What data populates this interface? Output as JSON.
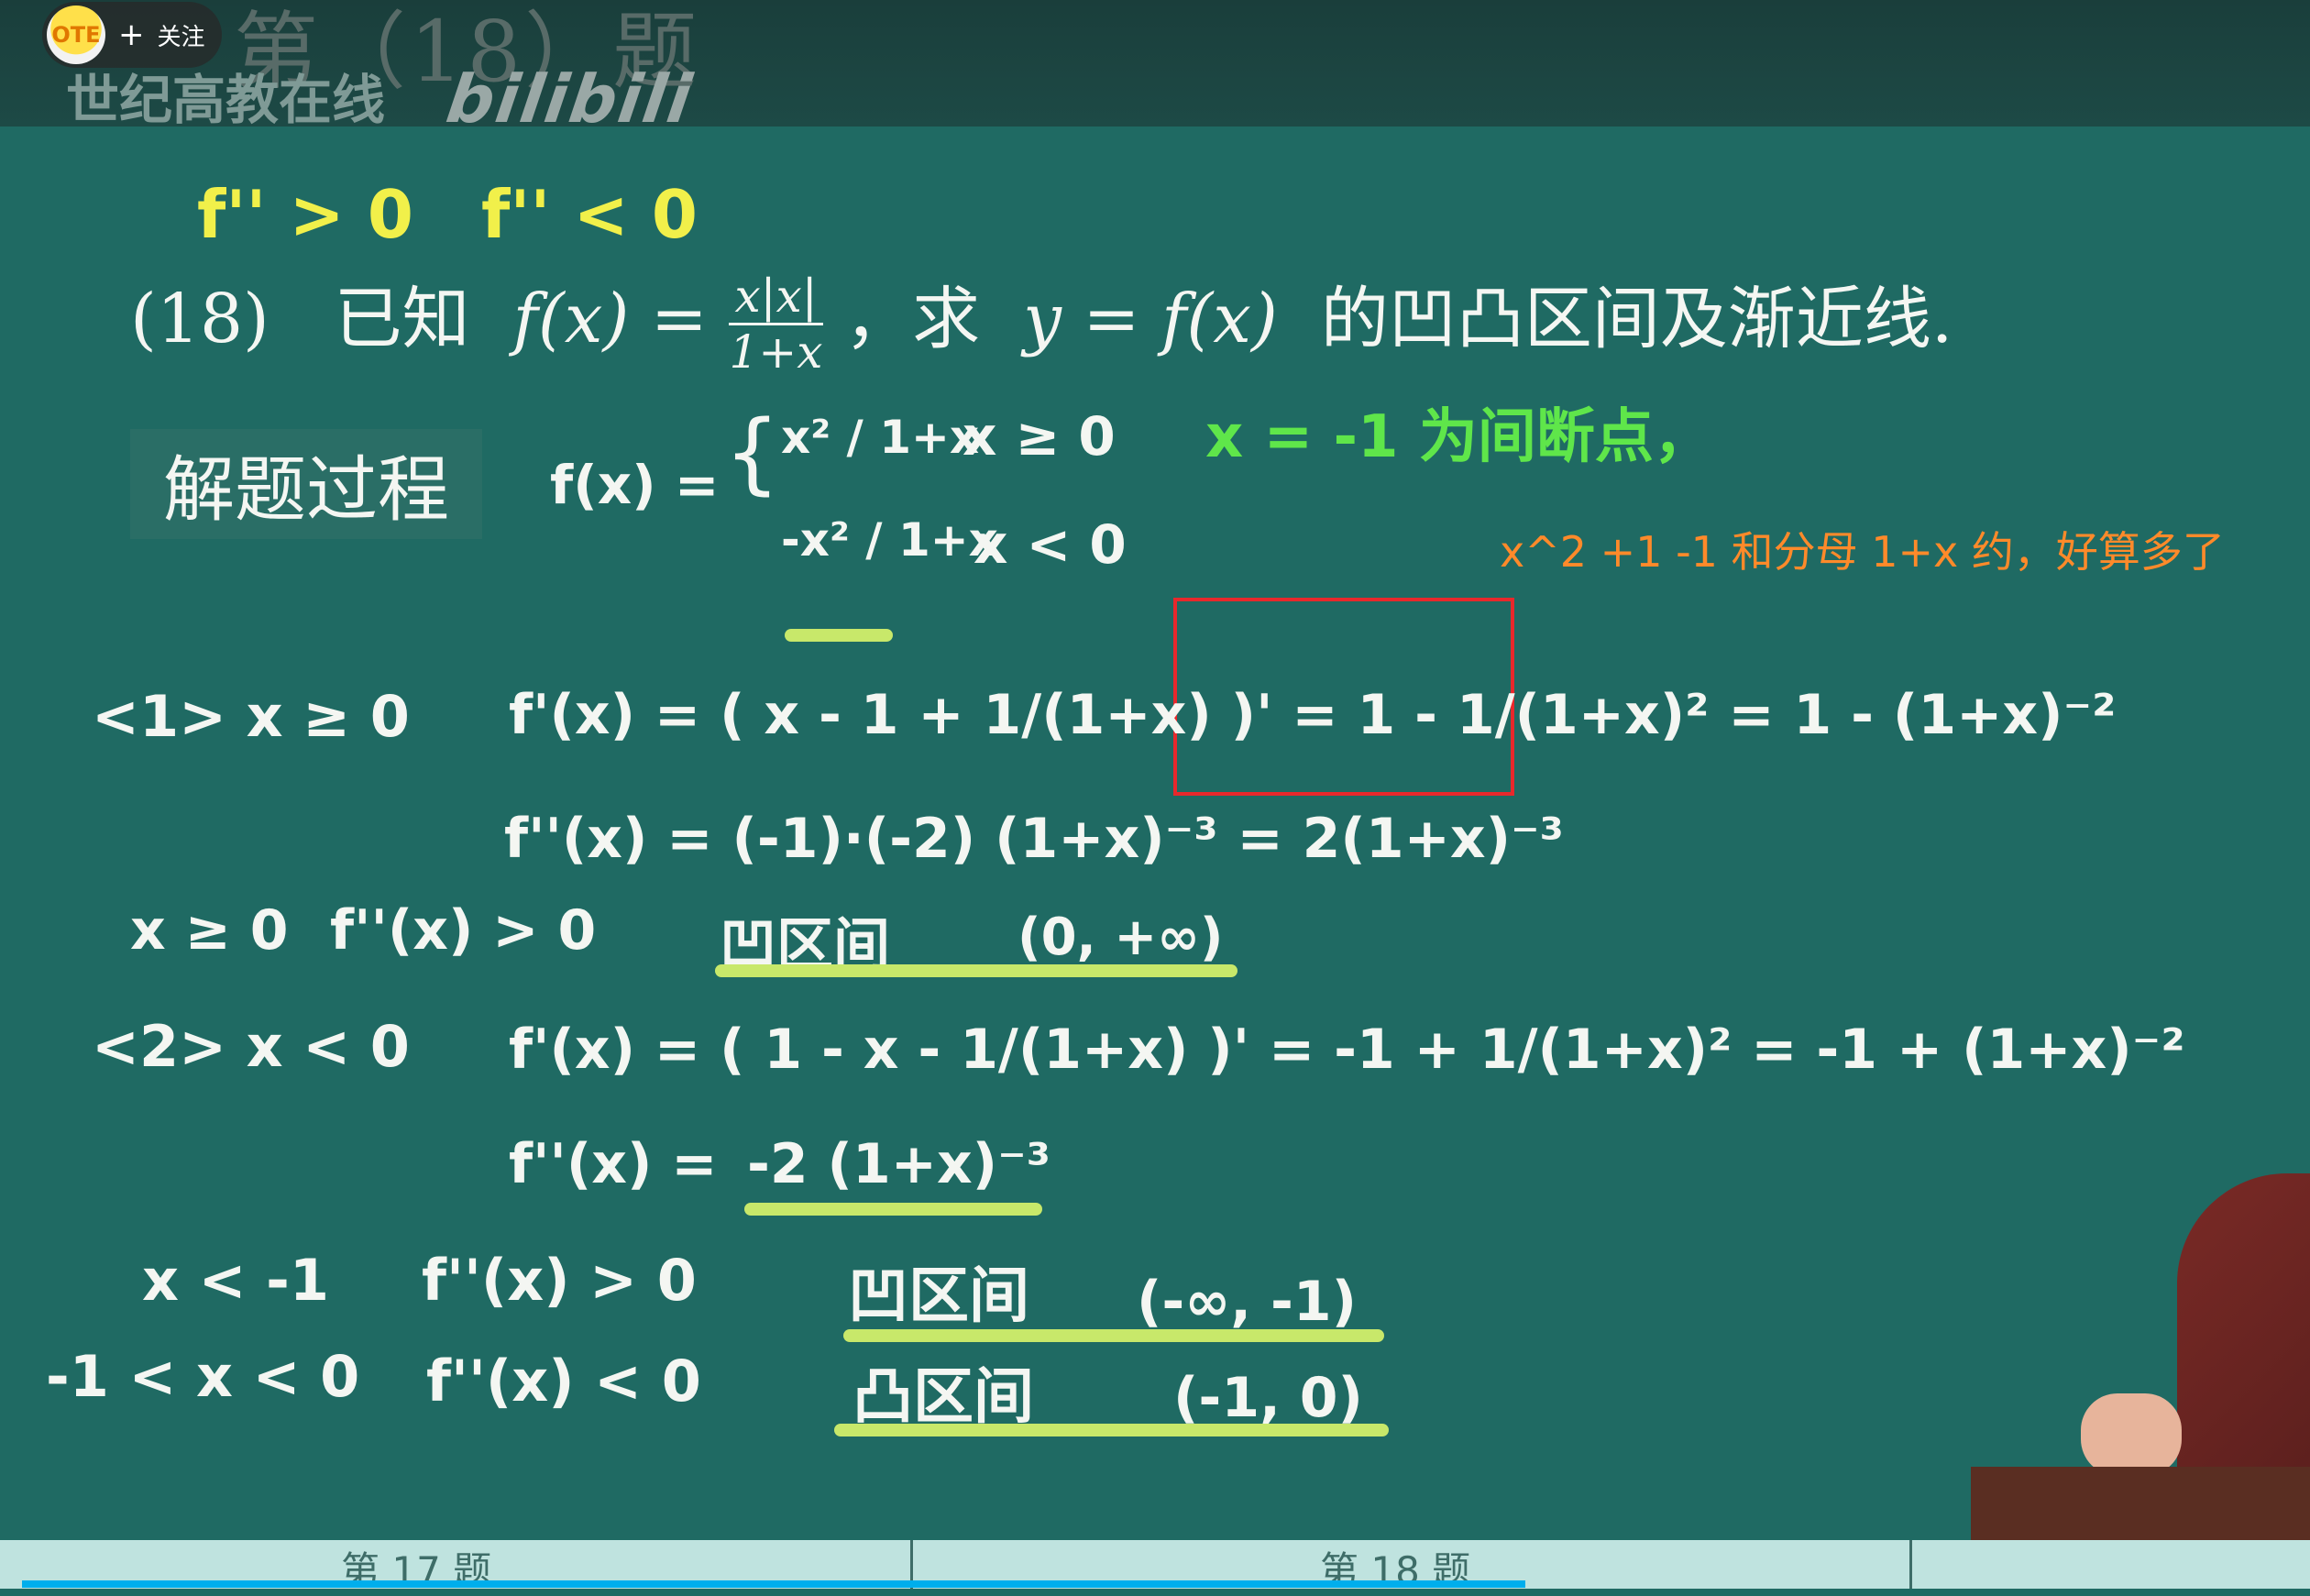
{
  "header": {
    "title": "第（18）题",
    "channel": "世纪高教在线",
    "watermark": "bilibili"
  },
  "follow": {
    "avatar_text": "OTE",
    "label": "关注",
    "plus": "+"
  },
  "problem": {
    "number": "(18)",
    "given": "已知",
    "function_lhs": "f(x) =",
    "frac_num": "x|x|",
    "frac_den": "1+x",
    "comma": "，求",
    "target": "y = f(x)",
    "rest": "的凹凸区间及渐近线."
  },
  "chalk": {
    "top_left_1": "f'' > 0",
    "top_left_2": "f'' < 0",
    "process_label": "解题过程",
    "fx_def": "f(x) =",
    "piece1": "x² / 1+x",
    "piece1_cond": "x ≥ 0",
    "piece2": "-x² / 1+x",
    "piece2_cond": "x < 0",
    "green_note": "x = -1 为间断点，",
    "case1_label": "<1>   x ≥ 0",
    "case1_fprime": "f'(x) = ( x - 1 + 1/(1+x) )' = 1 - 1/(1+x)² = 1 - (1+x)⁻²",
    "case1_fpp": "f''(x) = (-1)·(-2) (1+x)⁻³  =  2(1+x)⁻³",
    "case1_cond": "x ≥ 0",
    "case1_sign": "f''(x) > 0",
    "case1_result": "凹区间",
    "case1_interval": "(0, +∞)",
    "case2_label": "<2>   x < 0",
    "case2_fprime": "f'(x) = ( 1 - x - 1/(1+x) )' = -1 + 1/(1+x)² = -1 + (1+x)⁻²",
    "case2_fpp_lhs": "f''(x) =",
    "case2_fpp_rhs": "-2 (1+x)⁻³",
    "row3_cond": "x < -1",
    "row3_sign": "f''(x) > 0",
    "row3_result": "凹区间",
    "row3_interval": "(-∞, -1)",
    "row4_cond": "-1 < x < 0",
    "row4_sign": "f''(x) < 0",
    "row4_result": "凸区间",
    "row4_interval": "(-1, 0)"
  },
  "annotation": {
    "text": "x^2 +1 -1 和分母 1+x 约，好算多了",
    "color": "#ff8a2a",
    "box_color": "#e8282c"
  },
  "bottom": {
    "tab_left": "第 17 题",
    "tab_mid": "第 18 题",
    "progress_color": "#00aeec"
  }
}
